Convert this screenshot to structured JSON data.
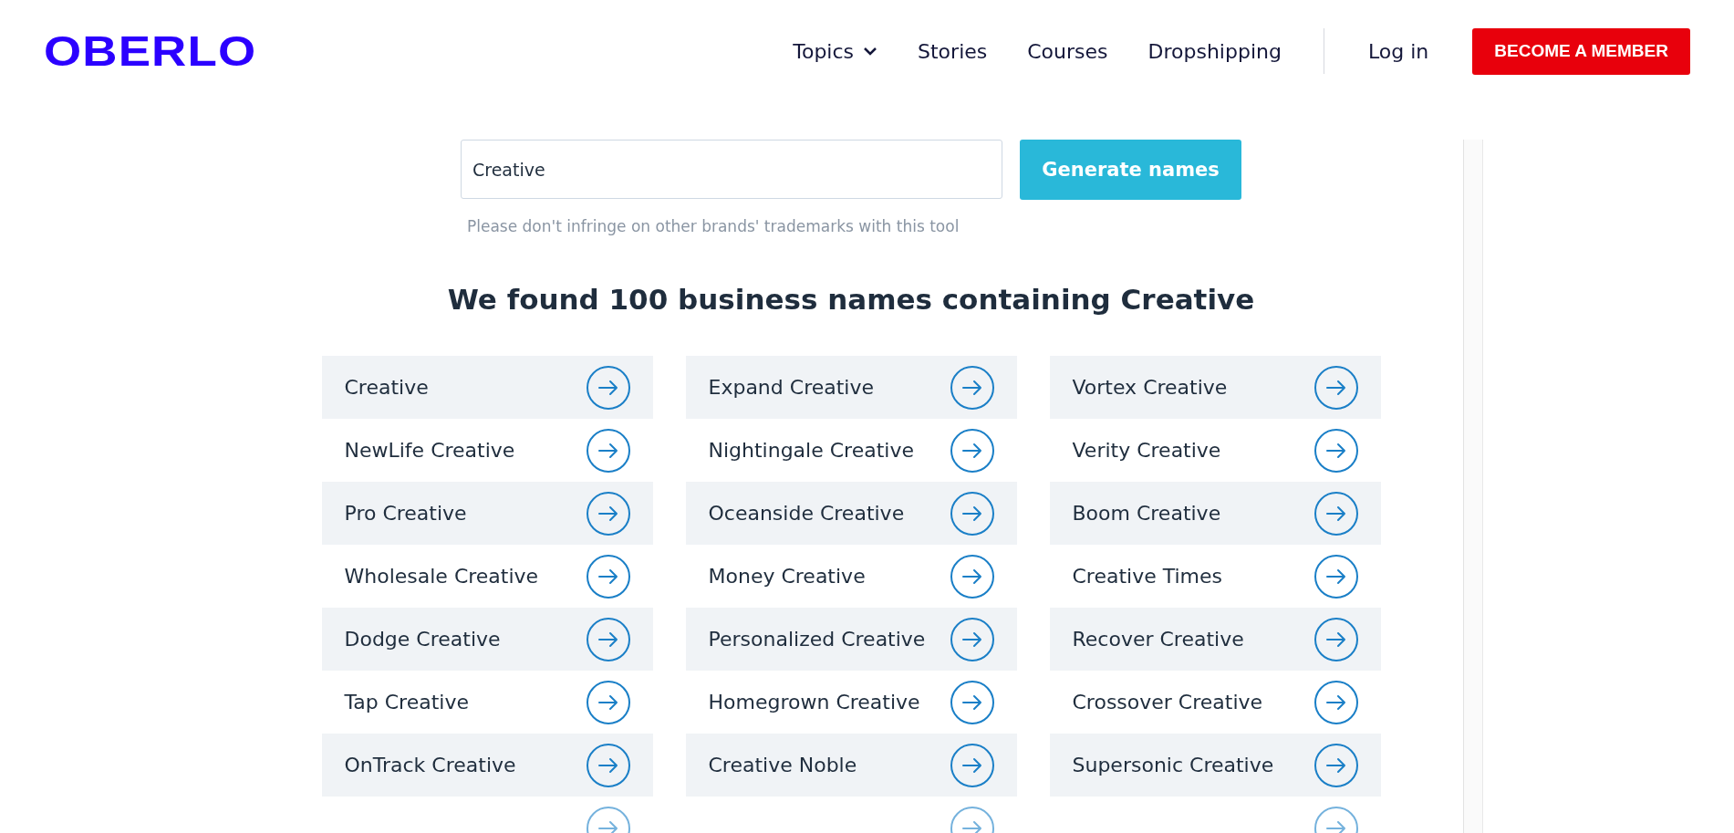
{
  "header": {
    "logo": "OBERLO",
    "nav": [
      {
        "label": "Topics",
        "dropdown": true
      },
      {
        "label": "Stories",
        "dropdown": false
      },
      {
        "label": "Courses",
        "dropdown": false
      },
      {
        "label": "Dropshipping",
        "dropdown": false
      }
    ],
    "login": "Log in",
    "cta": "BECOME A MEMBER"
  },
  "search": {
    "value": "Creative",
    "button": "Generate names",
    "hint": "Please don't infringe on other brands' trademarks with this tool"
  },
  "results": {
    "heading": "We found 100 business names containing Creative",
    "rows": [
      [
        "Creative",
        "Expand Creative",
        "Vortex Creative"
      ],
      [
        "NewLife Creative",
        "Nightingale Creative",
        "Verity Creative"
      ],
      [
        "Pro Creative",
        "Oceanside Creative",
        "Boom Creative"
      ],
      [
        "Wholesale Creative",
        "Money Creative",
        "Creative Times"
      ],
      [
        "Dodge Creative",
        "Personalized Creative",
        "Recover Creative"
      ],
      [
        "Tap Creative",
        "Homegrown Creative",
        "Crossover Creative"
      ],
      [
        "OnTrack Creative",
        "Creative Noble",
        "Supersonic Creative"
      ]
    ]
  }
}
